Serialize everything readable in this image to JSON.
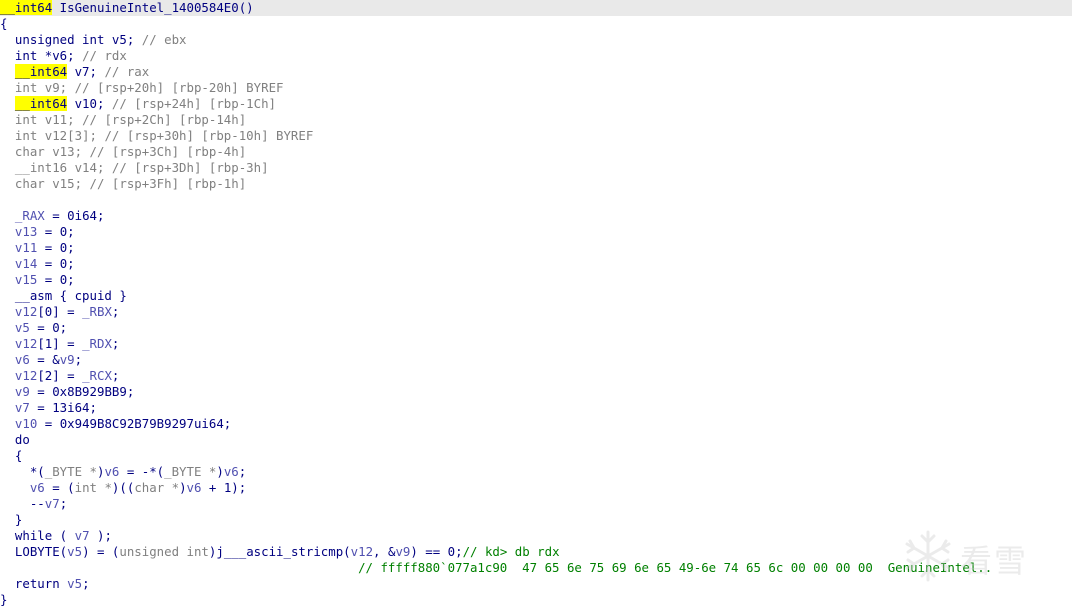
{
  "watermark": {
    "text": "看雪",
    "icon": "snowflake-icon"
  },
  "lines": [
    [
      {
        "t": "__int64",
        "c": "hl"
      },
      {
        "t": " IsGenuineIntel_1400584E0()",
        "c": "k"
      }
    ],
    [
      {
        "t": "{",
        "c": "k"
      }
    ],
    [
      {
        "t": "  unsigned int v5; ",
        "c": "k"
      },
      {
        "t": "// ebx",
        "c": "c"
      }
    ],
    [
      {
        "t": "  int *v6; ",
        "c": "k"
      },
      {
        "t": "// rdx",
        "c": "c"
      }
    ],
    [
      {
        "t": "  ",
        "c": "k"
      },
      {
        "t": "__int64",
        "c": "hl"
      },
      {
        "t": " v7; ",
        "c": "k"
      },
      {
        "t": "// rax",
        "c": "c"
      }
    ],
    [
      {
        "t": "  int v9; ",
        "c": "c"
      },
      {
        "t": "// [rsp+20h] [rbp-20h] BYREF",
        "c": "c"
      }
    ],
    [
      {
        "t": "  ",
        "c": "k"
      },
      {
        "t": "__int64",
        "c": "hl"
      },
      {
        "t": " v10; ",
        "c": "k"
      },
      {
        "t": "// [rsp+24h] [rbp-1Ch]",
        "c": "c"
      }
    ],
    [
      {
        "t": "  int v11; ",
        "c": "c"
      },
      {
        "t": "// [rsp+2Ch] [rbp-14h]",
        "c": "c"
      }
    ],
    [
      {
        "t": "  int v12[3]; ",
        "c": "c"
      },
      {
        "t": "// [rsp+30h] [rbp-10h] BYREF",
        "c": "c"
      }
    ],
    [
      {
        "t": "  char v13; ",
        "c": "c"
      },
      {
        "t": "// [rsp+3Ch] [rbp-4h]",
        "c": "c"
      }
    ],
    [
      {
        "t": "  __int16 v14; ",
        "c": "c"
      },
      {
        "t": "// [rsp+3Dh] [rbp-3h]",
        "c": "c"
      }
    ],
    [
      {
        "t": "  char v15; ",
        "c": "c"
      },
      {
        "t": "// [rsp+3Fh] [rbp-1h]",
        "c": "c"
      }
    ],
    [
      {
        "t": "",
        "c": "k"
      }
    ],
    [
      {
        "t": "  _RAX",
        "c": "v"
      },
      {
        "t": " = 0i64;",
        "c": "k"
      }
    ],
    [
      {
        "t": "  v13",
        "c": "v"
      },
      {
        "t": " = 0;",
        "c": "k"
      }
    ],
    [
      {
        "t": "  v11",
        "c": "v"
      },
      {
        "t": " = 0;",
        "c": "k"
      }
    ],
    [
      {
        "t": "  v14",
        "c": "v"
      },
      {
        "t": " = 0;",
        "c": "k"
      }
    ],
    [
      {
        "t": "  v15",
        "c": "v"
      },
      {
        "t": " = 0;",
        "c": "k"
      }
    ],
    [
      {
        "t": "  __asm { cpuid }",
        "c": "k"
      }
    ],
    [
      {
        "t": "  v12",
        "c": "v"
      },
      {
        "t": "[0] = ",
        "c": "k"
      },
      {
        "t": "_RBX",
        "c": "v"
      },
      {
        "t": ";",
        "c": "k"
      }
    ],
    [
      {
        "t": "  v5",
        "c": "v"
      },
      {
        "t": " = 0;",
        "c": "k"
      }
    ],
    [
      {
        "t": "  v12",
        "c": "v"
      },
      {
        "t": "[1] = ",
        "c": "k"
      },
      {
        "t": "_RDX",
        "c": "v"
      },
      {
        "t": ";",
        "c": "k"
      }
    ],
    [
      {
        "t": "  v6",
        "c": "v"
      },
      {
        "t": " = &",
        "c": "k"
      },
      {
        "t": "v9",
        "c": "v"
      },
      {
        "t": ";",
        "c": "k"
      }
    ],
    [
      {
        "t": "  v12",
        "c": "v"
      },
      {
        "t": "[2] = ",
        "c": "k"
      },
      {
        "t": "_RCX",
        "c": "v"
      },
      {
        "t": ";",
        "c": "k"
      }
    ],
    [
      {
        "t": "  v9",
        "c": "v"
      },
      {
        "t": " = 0x8B929BB9;",
        "c": "k"
      }
    ],
    [
      {
        "t": "  v7",
        "c": "v"
      },
      {
        "t": " = 13i64;",
        "c": "k"
      }
    ],
    [
      {
        "t": "  v10",
        "c": "v"
      },
      {
        "t": " = 0x949B8C92B79B9297ui64;",
        "c": "k"
      }
    ],
    [
      {
        "t": "  do",
        "c": "k"
      }
    ],
    [
      {
        "t": "  {",
        "c": "k"
      }
    ],
    [
      {
        "t": "    *(",
        "c": "k"
      },
      {
        "t": "_BYTE *",
        "c": "c"
      },
      {
        "t": ")",
        "c": "k"
      },
      {
        "t": "v6",
        "c": "v"
      },
      {
        "t": " = -*(",
        "c": "k"
      },
      {
        "t": "_BYTE *",
        "c": "c"
      },
      {
        "t": ")",
        "c": "k"
      },
      {
        "t": "v6",
        "c": "v"
      },
      {
        "t": ";",
        "c": "k"
      }
    ],
    [
      {
        "t": "    v6",
        "c": "v"
      },
      {
        "t": " = (",
        "c": "k"
      },
      {
        "t": "int *",
        "c": "c"
      },
      {
        "t": ")((",
        "c": "k"
      },
      {
        "t": "char *",
        "c": "c"
      },
      {
        "t": ")",
        "c": "k"
      },
      {
        "t": "v6",
        "c": "v"
      },
      {
        "t": " + 1);",
        "c": "k"
      }
    ],
    [
      {
        "t": "    --",
        "c": "k"
      },
      {
        "t": "v7",
        "c": "v"
      },
      {
        "t": ";",
        "c": "k"
      }
    ],
    [
      {
        "t": "  }",
        "c": "k"
      }
    ],
    [
      {
        "t": "  while ( ",
        "c": "k"
      },
      {
        "t": "v7",
        "c": "v"
      },
      {
        "t": " );",
        "c": "k"
      }
    ],
    [
      {
        "t": "  LOBYTE(",
        "c": "k"
      },
      {
        "t": "v5",
        "c": "v"
      },
      {
        "t": ") = (",
        "c": "k"
      },
      {
        "t": "unsigned int",
        "c": "c"
      },
      {
        "t": ")j___ascii_stricmp(",
        "c": "k"
      },
      {
        "t": "v12",
        "c": "v"
      },
      {
        "t": ", &",
        "c": "k"
      },
      {
        "t": "v9",
        "c": "v"
      },
      {
        "t": ") == 0;",
        "c": "k"
      },
      {
        "t": "// kd> db rdx",
        "c": "g"
      }
    ],
    [
      {
        "t": "                                                // fffff880`077a1c90  47 65 6e 75 69 6e 65 49-6e 74 65 6c 00 00 00 00  GenuineIntel..",
        "c": "g"
      }
    ],
    [
      {
        "t": "  return ",
        "c": "k"
      },
      {
        "t": "v5",
        "c": "v"
      },
      {
        "t": ";",
        "c": "k"
      }
    ],
    [
      {
        "t": "}",
        "c": "k"
      }
    ]
  ]
}
